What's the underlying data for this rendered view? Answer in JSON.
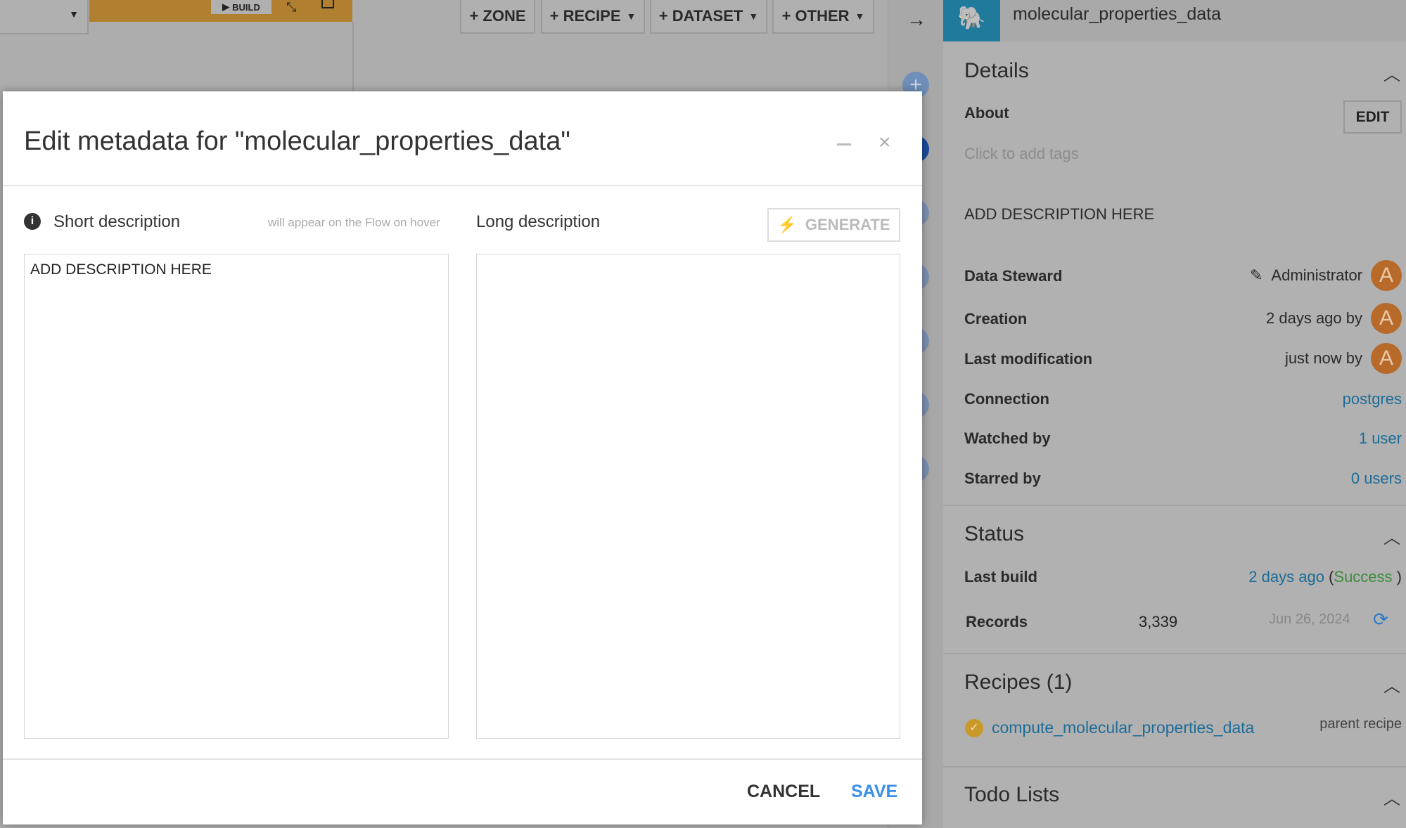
{
  "toolbar": {
    "build": "BUILD",
    "zone": "+ ZONE",
    "recipe": "+ RECIPE",
    "dataset": "+ DATASET",
    "other": "+ OTHER"
  },
  "modal": {
    "title": "Edit metadata for \"molecular_properties_data\"",
    "short_label": "Short description",
    "short_hint": "will appear on the Flow on hover",
    "long_label": "Long description",
    "generate": "GENERATE",
    "short_value": "ADD DESCRIPTION HERE",
    "long_value": "",
    "cancel": "CANCEL",
    "save": "SAVE"
  },
  "panel": {
    "dataset_name": "molecular_properties_data",
    "details": {
      "title": "Details",
      "about": "About",
      "edit": "EDIT",
      "tags_placeholder": "Click to add tags",
      "description": "ADD DESCRIPTION HERE",
      "rows": [
        {
          "label": "Data Steward",
          "value": "Administrator",
          "avatar": "A"
        },
        {
          "label": "Creation",
          "value": "2 days ago by",
          "avatar": "A"
        },
        {
          "label": "Last modification",
          "value": "just now by",
          "avatar": "A"
        },
        {
          "label": "Connection",
          "value": "postgres"
        },
        {
          "label": "Watched by",
          "value": "1 user"
        },
        {
          "label": "Starred by",
          "value": "0 users"
        }
      ]
    },
    "status": {
      "title": "Status",
      "last_build_label": "Last build",
      "last_build_time": "2 days ago",
      "last_build_result": "Success",
      "records_label": "Records",
      "records_value": "3,339",
      "records_date": "Jun 26, 2024"
    },
    "recipes": {
      "title": "Recipes (1)",
      "item": "compute_molecular_properties_data",
      "item_role": "parent recipe"
    },
    "todo": {
      "title": "Todo Lists"
    }
  },
  "colors": {
    "accent": "#3b8fe8",
    "link": "#1d6c98",
    "success": "#3c8a3c",
    "build_bar": "#b08030",
    "avatar": "#b86a2a"
  }
}
